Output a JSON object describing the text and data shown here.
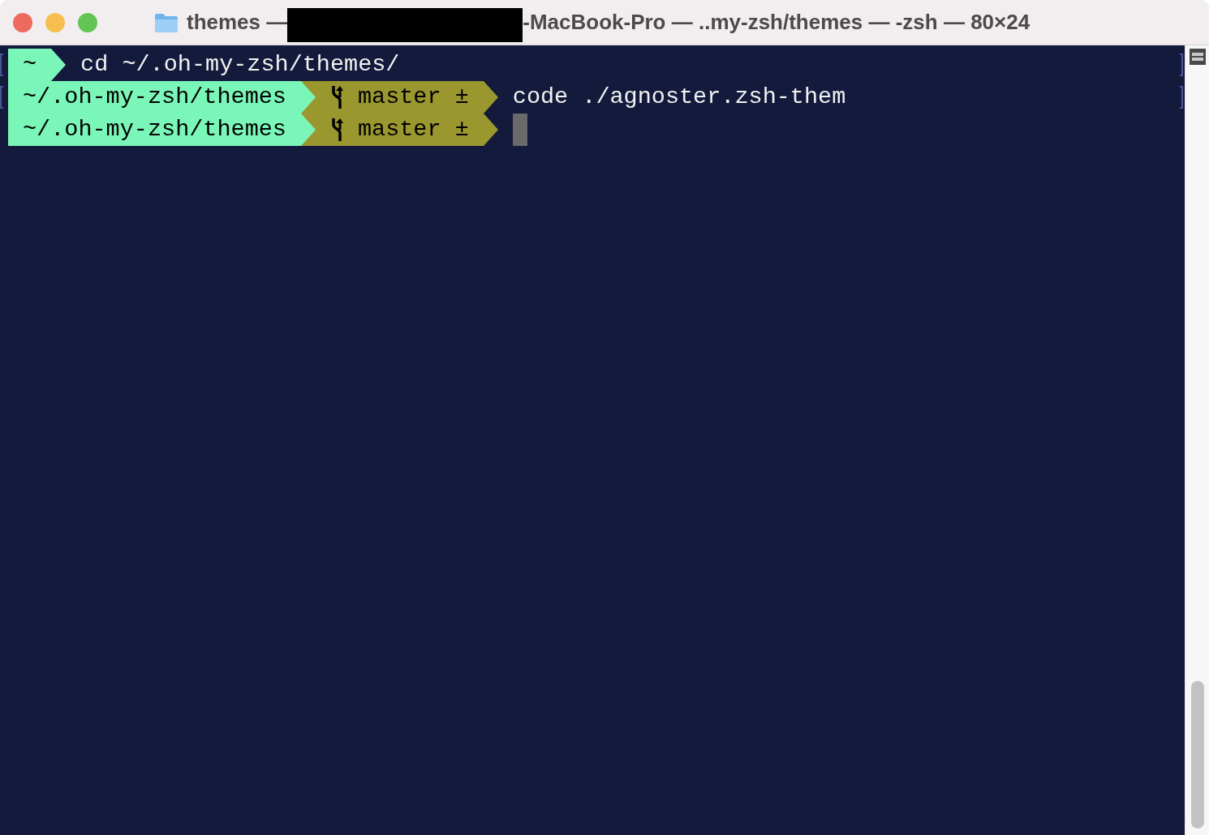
{
  "window": {
    "title_start": "themes —",
    "title_end": "-MacBook-Pro — ..my-zsh/themes — -zsh — 80×24"
  },
  "lines": [
    {
      "marked": true,
      "cursor": false,
      "segments": [
        {
          "kind": "dir",
          "text": "~"
        }
      ],
      "command": "cd ~/.oh-my-zsh/themes/"
    },
    {
      "marked": true,
      "cursor": false,
      "segments": [
        {
          "kind": "dir",
          "text": "~/.oh-my-zsh/themes"
        },
        {
          "kind": "git",
          "text": "master ±"
        }
      ],
      "command": "code ./agnoster.zsh-them"
    },
    {
      "marked": false,
      "cursor": true,
      "segments": [
        {
          "kind": "dir",
          "text": "~/.oh-my-zsh/themes"
        },
        {
          "kind": "git",
          "text": "master ±"
        }
      ]
    }
  ]
}
